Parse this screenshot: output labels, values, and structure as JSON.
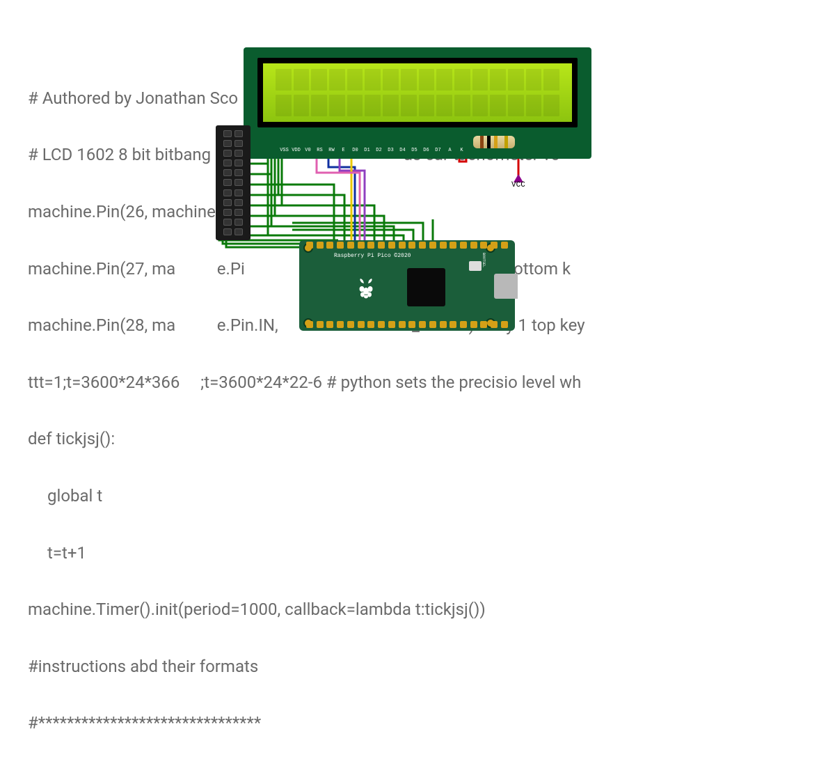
{
  "code": {
    "line1": "# Authored by Jonathan Sco                                           WI",
    "line2": "# LCD 1602 8 bit bitbang Fo                                         as car tachometer vo",
    "line3": "machine.Pin(26, machine.Pi",
    "line4": "machine.Pin(27, ma          e.Pi                                         WN) #key 2 bottom k",
    "line5": "machine.Pin(28, ma          e.Pin.IN,                Pin.PULL_DOWN) #key 1 top key",
    "line6": "ttt=1;t=3600*24*366     ;t=3600*24*22-6 # python sets the precisio level wh",
    "line7": "def tickjsj():",
    "line8": "global t",
    "line9": "t=t+1",
    "line10": "machine.Timer().init(period=1000, callback=lambda t:tickjsj())",
    "line11": "#instructions abd their formats",
    "line12": "#*******************************"
  },
  "lcd": {
    "pin_labels": [
      "VSS",
      "VDD",
      "V0",
      "RS",
      "RW",
      "E",
      "D0",
      "D1",
      "D2",
      "D3",
      "D4",
      "D5",
      "D6",
      "D7",
      "A",
      "K"
    ],
    "char_rows": 2,
    "char_cols": 16
  },
  "pico": {
    "label": "Raspberry Pi Pico ©2020",
    "bootsel": "BOOTSEL",
    "usb": "USB",
    "pins_per_side": 20
  },
  "vcc": {
    "label": "VCC"
  },
  "header": {
    "rows": 11
  },
  "colors": {
    "wire_green": "#0a7a0a",
    "wire_red": "#d40000",
    "wire_blue": "#1030a0",
    "wire_purple": "#9040c0",
    "wire_yellow": "#e8c800",
    "wire_pink": "#e060b0"
  }
}
